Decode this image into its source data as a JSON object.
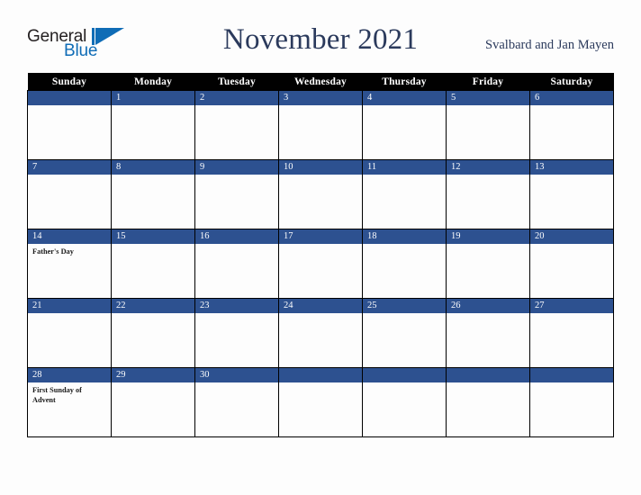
{
  "brand": {
    "name_part1": "General",
    "name_part2": "Blue",
    "triangle_color": "#0f6cb6",
    "text_color": "#231f20"
  },
  "header": {
    "title": "November 2021",
    "locale": "Svalbard and Jan Mayen",
    "title_color": "#2b3a5c"
  },
  "calendar": {
    "header_bg": "#010101",
    "daybar_bg": "#2d5190",
    "cell_bg": "#fdfdfd",
    "border_color": "#000000",
    "weekday_headers": [
      "Sunday",
      "Monday",
      "Tuesday",
      "Wednesday",
      "Thursday",
      "Friday",
      "Saturday"
    ],
    "weeks": [
      [
        {
          "num": "",
          "events": []
        },
        {
          "num": "1",
          "events": []
        },
        {
          "num": "2",
          "events": []
        },
        {
          "num": "3",
          "events": []
        },
        {
          "num": "4",
          "events": []
        },
        {
          "num": "5",
          "events": []
        },
        {
          "num": "6",
          "events": []
        }
      ],
      [
        {
          "num": "7",
          "events": []
        },
        {
          "num": "8",
          "events": []
        },
        {
          "num": "9",
          "events": []
        },
        {
          "num": "10",
          "events": []
        },
        {
          "num": "11",
          "events": []
        },
        {
          "num": "12",
          "events": []
        },
        {
          "num": "13",
          "events": []
        }
      ],
      [
        {
          "num": "14",
          "events": [
            "Father's Day"
          ]
        },
        {
          "num": "15",
          "events": []
        },
        {
          "num": "16",
          "events": []
        },
        {
          "num": "17",
          "events": []
        },
        {
          "num": "18",
          "events": []
        },
        {
          "num": "19",
          "events": []
        },
        {
          "num": "20",
          "events": []
        }
      ],
      [
        {
          "num": "21",
          "events": []
        },
        {
          "num": "22",
          "events": []
        },
        {
          "num": "23",
          "events": []
        },
        {
          "num": "24",
          "events": []
        },
        {
          "num": "25",
          "events": []
        },
        {
          "num": "26",
          "events": []
        },
        {
          "num": "27",
          "events": []
        }
      ],
      [
        {
          "num": "28",
          "events": [
            "First Sunday of Advent"
          ]
        },
        {
          "num": "29",
          "events": []
        },
        {
          "num": "30",
          "events": []
        },
        {
          "num": "",
          "events": []
        },
        {
          "num": "",
          "events": []
        },
        {
          "num": "",
          "events": []
        },
        {
          "num": "",
          "events": []
        }
      ]
    ]
  }
}
